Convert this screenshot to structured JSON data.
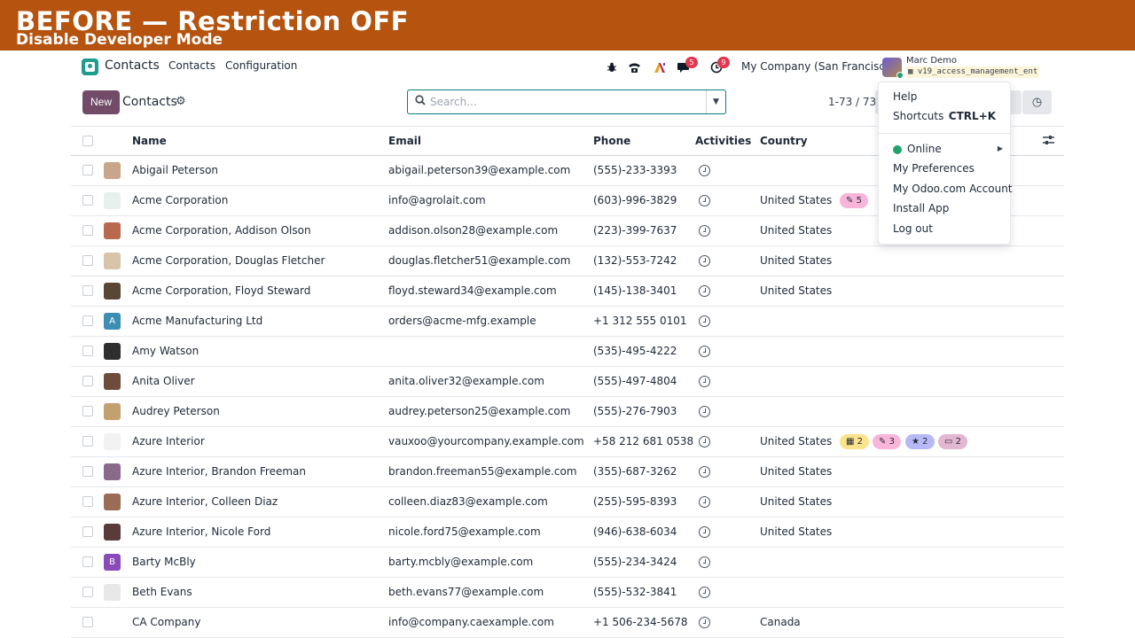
{
  "banner": {
    "title": "BEFORE — Restriction OFF",
    "subtitle": "Disable Developer Mode"
  },
  "navbar": {
    "brand": "Contacts",
    "menus": [
      "Contacts",
      "Configuration"
    ],
    "chat_badge": "5",
    "activity_badge": "9",
    "company": "My Company (San Francisco)",
    "user_name": "Marc Demo",
    "database": "v19_access_management_ent"
  },
  "control_panel": {
    "new_label": "New",
    "title": "Contacts",
    "search_placeholder": "Search...",
    "pager": "1-73 / 73"
  },
  "table": {
    "columns": [
      "Name",
      "Email",
      "Phone",
      "Activities",
      "Country"
    ],
    "rows": [
      {
        "name": "Abigail Peterson",
        "email": "abigail.peterson39@example.com",
        "phone": "(555)-233-3393",
        "country": ""
      },
      {
        "name": "Acme Corporation",
        "email": "info@agrolait.com",
        "phone": "(603)-996-3829",
        "country": "United States"
      },
      {
        "name": "Acme Corporation, Addison Olson",
        "email": "addison.olson28@example.com",
        "phone": "(223)-399-7637",
        "country": "United States"
      },
      {
        "name": "Acme Corporation, Douglas Fletcher",
        "email": "douglas.fletcher51@example.com",
        "phone": "(132)-553-7242",
        "country": "United States"
      },
      {
        "name": "Acme Corporation, Floyd Steward",
        "email": "floyd.steward34@example.com",
        "phone": "(145)-138-3401",
        "country": "United States"
      },
      {
        "name": "Acme Manufacturing Ltd",
        "email": "orders@acme-mfg.example",
        "phone": "+1 312 555 0101",
        "country": "",
        "initial": "A"
      },
      {
        "name": "Amy Watson",
        "email": "",
        "phone": "(535)-495-4222",
        "country": ""
      },
      {
        "name": "Anita Oliver",
        "email": "anita.oliver32@example.com",
        "phone": "(555)-497-4804",
        "country": ""
      },
      {
        "name": "Audrey Peterson",
        "email": "audrey.peterson25@example.com",
        "phone": "(555)-276-7903",
        "country": ""
      },
      {
        "name": "Azure Interior",
        "email": "vauxoo@yourcompany.example.com",
        "phone": "+58 212 681 0538",
        "country": "United States"
      },
      {
        "name": "Azure Interior, Brandon Freeman",
        "email": "brandon.freeman55@example.com",
        "phone": "(355)-687-3262",
        "country": "United States"
      },
      {
        "name": "Azure Interior, Colleen Diaz",
        "email": "colleen.diaz83@example.com",
        "phone": "(255)-595-8393",
        "country": "United States"
      },
      {
        "name": "Azure Interior, Nicole Ford",
        "email": "nicole.ford75@example.com",
        "phone": "(946)-638-6034",
        "country": "United States"
      },
      {
        "name": "Barty McBly",
        "email": "barty.mcbly@example.com",
        "phone": "(555)-234-3424",
        "country": "",
        "initial": "B"
      },
      {
        "name": "Beth Evans",
        "email": "beth.evans77@example.com",
        "phone": "(555)-532-3841",
        "country": ""
      },
      {
        "name": "CA Company",
        "email": "info@company.caexample.com",
        "phone": "+1 506-234-5678",
        "country": "Canada"
      }
    ],
    "acme_tags": [
      {
        "icon": "✎",
        "count": "5",
        "color": "#f9b5d9"
      }
    ],
    "azure_tags": [
      {
        "icon": "▦",
        "count": "2",
        "color": "#fce28c"
      },
      {
        "icon": "✎",
        "count": "3",
        "color": "#f9b5d9"
      },
      {
        "icon": "★",
        "count": "2",
        "color": "#b7b9f5"
      },
      {
        "icon": "▭",
        "count": "2",
        "color": "#e3b6d2"
      }
    ]
  },
  "user_menu": {
    "help": "Help",
    "shortcuts": "Shortcuts",
    "shortcuts_key": "CTRL+K",
    "online": "Online",
    "preferences": "My Preferences",
    "odoo_account": "My Odoo.com Account",
    "install_app": "Install App",
    "logout": "Log out"
  },
  "colors": {
    "banner": "#b5530f",
    "primary": "#714b67",
    "accent": "#017e84",
    "online": "#22a36b",
    "badge": "#e0384f"
  },
  "icons": [
    "bug-icon",
    "phone-icon",
    "ai-icon",
    "chat-icon",
    "activity-clock-icon",
    "gear-icon",
    "search-icon",
    "optional-columns-icon"
  ]
}
